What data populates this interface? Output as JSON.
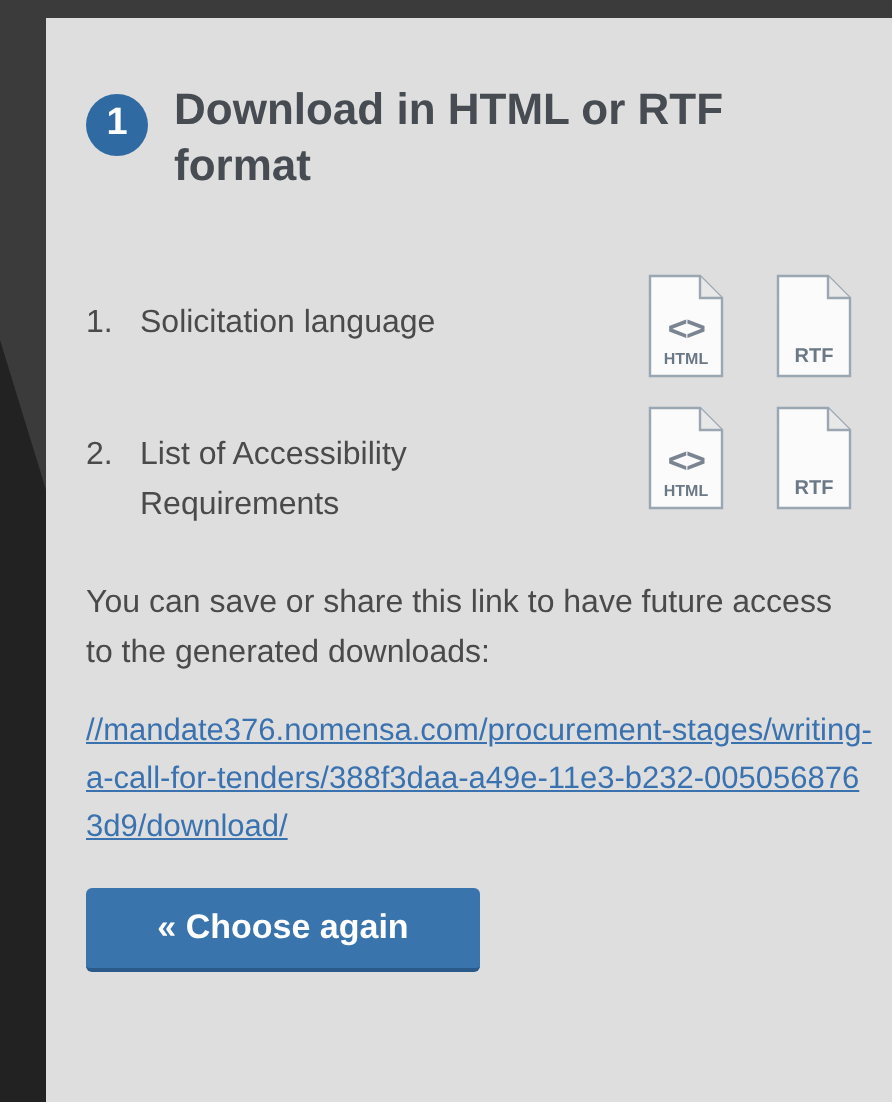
{
  "step": {
    "number": "1",
    "title": "Download in HTML or RTF format"
  },
  "documents": [
    {
      "index": "1.",
      "name": "Solicitation language",
      "formats": [
        {
          "kind": "html",
          "symbol": "<>",
          "label": "HTML"
        },
        {
          "kind": "rtf",
          "label": "RTF"
        }
      ]
    },
    {
      "index": "2.",
      "name": "List of Accessibility Requirements",
      "formats": [
        {
          "kind": "html",
          "symbol": "<>",
          "label": "HTML"
        },
        {
          "kind": "rtf",
          "label": "RTF"
        }
      ]
    }
  ],
  "share_text": "You can save or share this link to have future access to the generated downloads:",
  "share_link": "//mandate376.nomensa.com/procurement-stages/writing-a-call-for-tenders/388f3daa-a49e-11e3-b232-0050568763d9/download/",
  "button": "« Choose again"
}
